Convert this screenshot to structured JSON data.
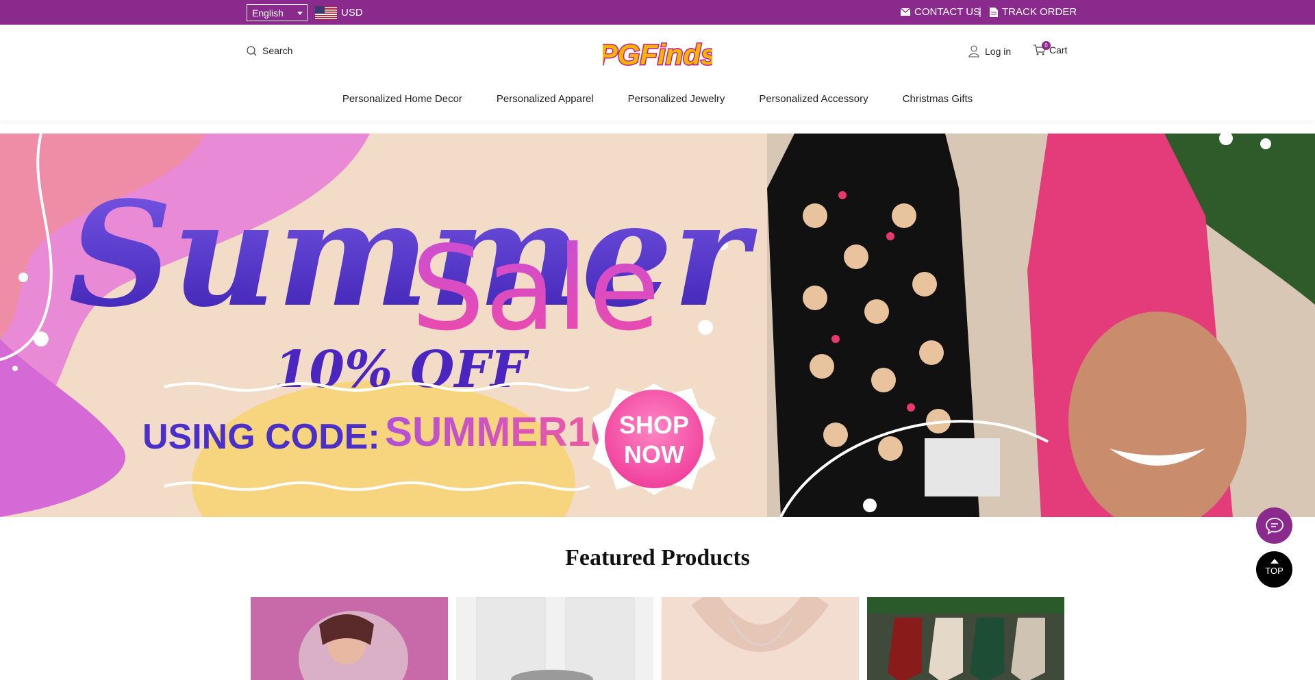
{
  "topbar": {
    "language": "English",
    "currency": "USD",
    "contact_label": "CONTACT US",
    "separator": "|",
    "track_label": "TRACK ORDER",
    "background": "#8a2a8c"
  },
  "header": {
    "search_label": "Search",
    "logo_text": "PGFinds",
    "login_label": "Log in",
    "cart_label": "Cart",
    "cart_count": "0"
  },
  "nav": {
    "items": [
      {
        "label": "Personalized Home Decor"
      },
      {
        "label": "Personalized Apparel"
      },
      {
        "label": "Personalized Jewelry"
      },
      {
        "label": "Personalized Accessory"
      },
      {
        "label": "Christmas Gifts"
      }
    ]
  },
  "banner": {
    "headline": "Summer",
    "subheadline": "Sale",
    "offer": "10% OFF",
    "code_prefix": "USING CODE:",
    "code": "SUMMER10",
    "cta_line1": "SHOP",
    "cta_line2": "NOW"
  },
  "featured": {
    "title": "Featured Products",
    "products": [
      {
        "name": "product-photo-girl-lamp"
      },
      {
        "name": "product-photo-pet-figurines"
      },
      {
        "name": "product-photo-necklace"
      },
      {
        "name": "product-photo-christmas-stockings"
      }
    ]
  },
  "floating": {
    "top_label": "TOP"
  },
  "colors": {
    "brand_purple": "#8a2a8c",
    "accent_pink": "#e23aa6",
    "accent_violet": "#4b2fc9"
  }
}
